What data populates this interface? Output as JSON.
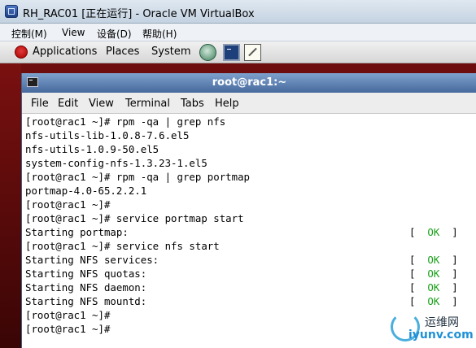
{
  "vbox": {
    "title": "RH_RAC01 [正在运行] - Oracle VM VirtualBox",
    "menu": [
      "控制(M)",
      "View",
      "设备(D)",
      "帮助(H)"
    ]
  },
  "gnome_panel": {
    "items": [
      "Applications",
      "Places",
      "System"
    ],
    "launchers": [
      "network-icon",
      "terminal-icon",
      "text-editor-icon"
    ]
  },
  "terminal": {
    "title": "root@rac1:~",
    "menu": [
      "File",
      "Edit",
      "View",
      "Terminal",
      "Tabs",
      "Help"
    ],
    "lines": [
      "[root@rac1 ~]# rpm -qa | grep nfs",
      "nfs-utils-lib-1.0.8-7.6.el5",
      "nfs-utils-1.0.9-50.el5",
      "system-config-nfs-1.3.23-1.el5",
      "[root@rac1 ~]# rpm -qa | grep portmap",
      "portmap-4.0-65.2.2.1",
      "[root@rac1 ~]#",
      "[root@rac1 ~]# service portmap start",
      "Starting portmap:",
      "[root@rac1 ~]# service nfs start",
      "Starting NFS services:",
      "Starting NFS quotas:",
      "Starting NFS daemon:",
      "Starting NFS mountd:",
      "[root@rac1 ~]#",
      "[root@rac1 ~]#"
    ],
    "status": [
      "OK",
      "OK",
      "OK",
      "OK",
      "OK"
    ],
    "status_bracket_open": "[",
    "status_bracket_close": "]"
  },
  "watermark": {
    "name": "运维网",
    "url": "iyunv.com"
  },
  "colors": {
    "ok": "#17a017",
    "terminal_title": "#46699c",
    "desktop": "#6e0d0d"
  }
}
